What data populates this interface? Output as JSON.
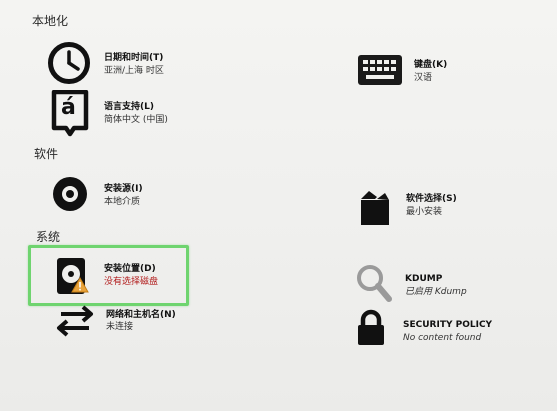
{
  "sections": {
    "localization": "本地化",
    "software": "软件",
    "system": "系统"
  },
  "spokes": {
    "datetime": {
      "title": "日期和时间(T)",
      "status": "亚洲/上海 时区",
      "icon": "clock-icon"
    },
    "keyboard": {
      "title": "键盘(K)",
      "status": "汉语",
      "icon": "keyboard-icon"
    },
    "language": {
      "title": "语言支持(L)",
      "status": "简体中文 (中国)",
      "icon": "language-icon",
      "glyph": "á"
    },
    "source": {
      "title": "安装源(I)",
      "status": "本地介质",
      "icon": "disc-icon"
    },
    "software": {
      "title": "软件选择(S)",
      "status": "最小安装",
      "icon": "package-icon"
    },
    "destination": {
      "title": "安装位置(D)",
      "status": "没有选择磁盘",
      "icon": "harddisk-icon",
      "warning_icon": "warning-icon"
    },
    "kdump": {
      "title": "KDUMP",
      "status": "已启用 Kdump",
      "icon": "search-icon"
    },
    "network": {
      "title": "网络和主机名(N)",
      "status": "未连接",
      "icon": "network-arrows-icon"
    },
    "security": {
      "title": "SECURITY POLICY",
      "status": "No content found",
      "icon": "lock-icon"
    }
  },
  "colors": {
    "highlight": "#6fd46f",
    "warning_text": "#b21d1d",
    "warning_icon": "#e8a33c"
  }
}
